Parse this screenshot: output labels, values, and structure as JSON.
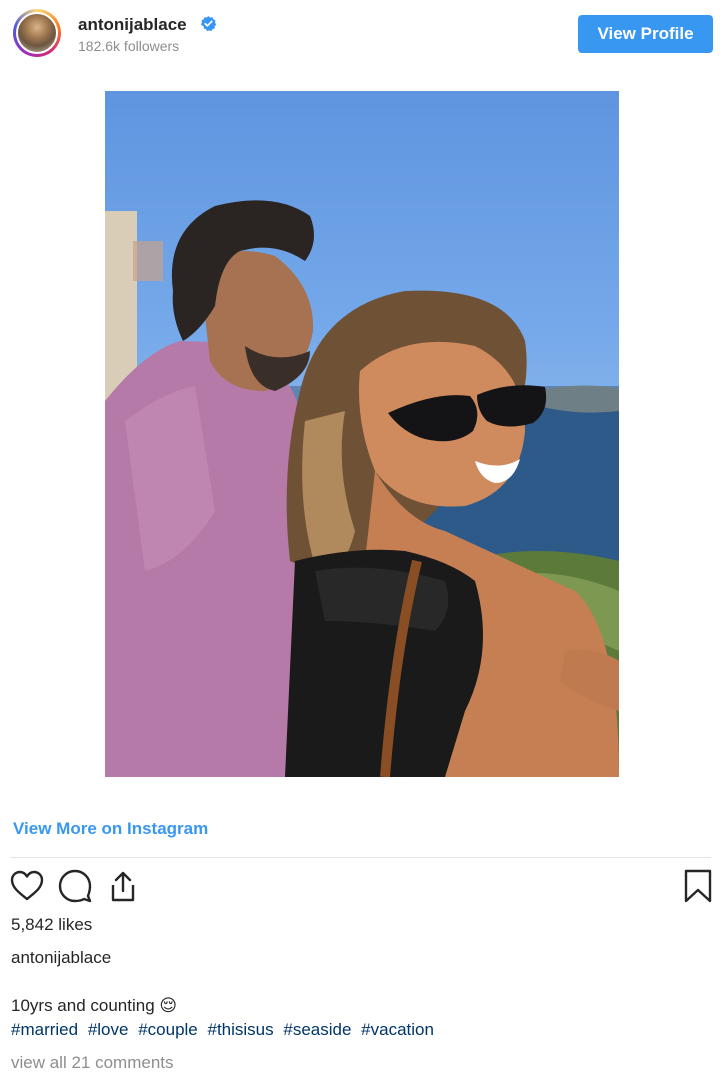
{
  "header": {
    "username": "antonijablace",
    "followers": "182.6k followers",
    "view_profile_label": "View Profile"
  },
  "post": {
    "view_more_label": "View More on Instagram",
    "likes": "5,842 likes",
    "caption_username": "antonijablace",
    "caption_text": "10yrs and counting 😌",
    "hashtags": [
      "#married",
      "#love",
      "#couple",
      "#thisisus",
      "#seaside",
      "#vacation"
    ],
    "comments_link": "view all 21 comments"
  },
  "colors": {
    "accent": "#3897f0",
    "hashtag": "#003569",
    "muted": "#8e8e8e",
    "text": "#262626"
  },
  "icons": [
    "verified-badge-icon",
    "heart-icon",
    "comment-icon",
    "share-icon",
    "bookmark-icon"
  ]
}
